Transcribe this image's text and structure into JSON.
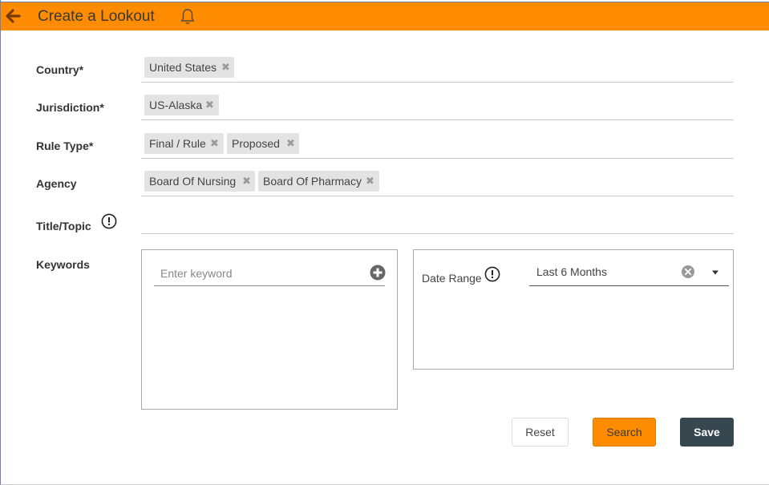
{
  "header": {
    "title": "Create a Lookout",
    "accent": "#ff8c00"
  },
  "form": {
    "country": {
      "label": "Country*",
      "chips": [
        "United States"
      ]
    },
    "jurisdiction": {
      "label": "Jurisdiction*",
      "chips": [
        "US-Alaska"
      ]
    },
    "rule_type": {
      "label": "Rule Type*",
      "chips": [
        "Final / Rule",
        "Proposed"
      ]
    },
    "agency": {
      "label": "Agency",
      "chips": [
        "Board Of Nursing",
        "Board Of Pharmacy"
      ]
    },
    "title_topic": {
      "label": "Title/Topic",
      "value": ""
    },
    "keywords": {
      "label": "Keywords",
      "placeholder": "Enter keyword"
    },
    "date_range": {
      "label": "Date Range",
      "selected": "Last 6 Months"
    }
  },
  "icons": {
    "back": "arrow-left-icon",
    "bell": "bell-icon",
    "info": "info-icon",
    "add": "plus-circle-icon",
    "clear": "clear-circle-icon",
    "caret": "caret-down-icon",
    "remove": "close-icon"
  },
  "buttons": {
    "reset": "Reset",
    "search": "Search",
    "save": "Save"
  },
  "colors": {
    "search_button": "#ff8c00",
    "save_button": "#37474f"
  }
}
